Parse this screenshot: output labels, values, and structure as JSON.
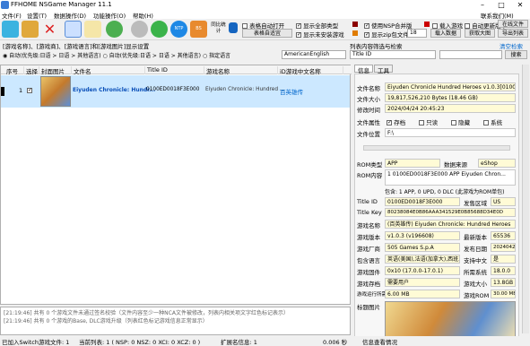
{
  "window": {
    "title": "FFHOME NSGame Manager 11.1",
    "minimize": "–",
    "maximize": "□",
    "close": "✕"
  },
  "menu": {
    "file": "文件(F)",
    "settings": "设置(T)",
    "data": "数据操作(D)",
    "function": "功能操作(O)",
    "help": "帮助(H)",
    "right_link": "联系我们(M)"
  },
  "toolbar": {
    "icons": [
      "new-file-icon",
      "folder-open-icon",
      "close-red-icon",
      "search-icon",
      "sleep-icon",
      "refresh-icon",
      "cancel-circle-icon",
      "checkmark-icon",
      "ntp-icon",
      "money-bag-icon",
      "palette-icon"
    ],
    "ntp_label": "NTP",
    "bs_label": "BS",
    "stats_label": "同比统计",
    "opt_auto_open": "表格自动打开",
    "opt_auto_open_checked": false,
    "opt_show_all_types": "显示全部类型",
    "opt_show_all_types_checked": true,
    "opt_real_name": "名称显示",
    "opt_real_name_checked": false,
    "opt_show_not_installed": "显示未安装游戏",
    "opt_show_not_installed_checked": true,
    "fit_width_btn": "表格自适宜",
    "opt_use_nsp_merge": "使用NSP合并版",
    "opt_use_nsp_merge_checked": true,
    "opt_show_nsz": "显示zip包文件名",
    "opt_show_nsz_checked": true,
    "count_value": "18",
    "opt_import_game": "载入游戏",
    "opt_import_game_checked": false,
    "opt_allow_comma": "允许逗号",
    "opt_allow_comma_checked": false,
    "load_db_btn": "载入数据",
    "opt_auto_update": "自动更新版本",
    "opt_auto_update_checked": false,
    "get_info_btn": "获取大图",
    "online_btn": "在线文件",
    "file_list_btn": "导出列表"
  },
  "filter": {
    "title": "[游戏名称]、[游戏商]、[游戏语言]和[游戏图片]显示设置",
    "row1_opt1": "自动(优先级:日语 > 日语 > 其他语言)",
    "row1_opt2": "自动(优先级:日语 > 日语 > 其他语言)",
    "row1_opt3": "指定语言",
    "lang_value": "AmericanEnglish",
    "search_title": "列表内容筛选与检索",
    "clear_link": "清空检索",
    "search_field": "Title ID",
    "search_value": "",
    "search_btn": "搜索"
  },
  "grid": {
    "headers": [
      "序号",
      "选择",
      "封面图片",
      "文件名",
      "Title ID",
      "游戏名称",
      "iD游戏中文名称"
    ],
    "rows": [
      {
        "no": "1",
        "checked": true,
        "filename": "Eiyuden Chronicle: Hundr...",
        "title_id": "0100ED0018F3E000",
        "game_name": "Eiyuden Chronicle: Hundred ...",
        "cn_name": "百英雄传"
      }
    ]
  },
  "log": {
    "line1": "[21:19:46] 共有 0 个游戏文件未通过签名校验（文件内容至少一种NCA文件被修改，列表内相关项文字红色标记表示）",
    "line2": "[21:19:46] 共有 0 个游戏的Base, DLC游戏升级（列表红色标记游戏信息正常显示）"
  },
  "status": {
    "load_count": "已加入Switch游戏文件: 1",
    "current": "当前列表: 1 ( NSP: 0  NSZ: 0  XCI: 0  XCZ: 0 )",
    "ext_data": "扩展名信息: 1",
    "size": "0.006 秒",
    "info_label": "信息查看情况"
  },
  "details": {
    "tabs": [
      "信息",
      "工具"
    ],
    "file_name_label": "文件名称",
    "file_name": "Eiyuden Chronicle Hundred Heroes v1.0.3[0100ED0...",
    "file_size_label": "文件大小",
    "file_size": "19,817,526,210 Bytes (18.46 GB)",
    "mod_time_label": "修改时间",
    "mod_time": "2024/04/24 20:45:23",
    "attr_label": "文件属性",
    "attr_archive": "存档",
    "attr_hidden": "只读",
    "attr_readonly": "隐藏",
    "attr_system": "系统",
    "attr_archive_checked": true,
    "attr_hidden_checked": false,
    "attr_readonly_checked": false,
    "attr_system_checked": false,
    "path_label": "文件位置",
    "path": "F:\\",
    "rom_type_label": "ROM类型",
    "rom_type": "APP",
    "data_source_label": "数据来源",
    "data_source": "eShop",
    "rom_content_label": "ROM内容",
    "rom_content": "1   0100ED0018F3E000   APP   Eiyuden Chron...",
    "content_summary": "包含: 1 APP, 0 UPD, 0 DLC  (此游戏为ROM单包)",
    "title_id_label": "Title ID",
    "title_id": "0100ED0018F3E000",
    "region_label": "发售区域",
    "region": "US",
    "title_key_label": "Title Key",
    "title_key": "80238084E0B86AAA341529E0B85688D34E0D",
    "game_name_label": "游戏名称",
    "game_name": "(百英雄传) Eiyuden Chronicle: Hundred Heroes",
    "version_label": "游戏版本",
    "version": "v1.0.3 (v196608)",
    "latest_version_label": "最新版本",
    "latest_version": "65536",
    "publisher_label": "游戏厂商",
    "publisher": "505 Games S.p.A",
    "release_label": "发布日期",
    "release": "20240423",
    "language_label": "包含语言",
    "language": "英语(美国),法语(加拿大),西班牙语(...",
    "lang_count_label": "支持中文",
    "lang_count": "是",
    "firmware_label": "游戏固件",
    "firmware": "0x10 (17.0.0-17.0.1)",
    "req_label": "所需系统",
    "req": "18.0.0",
    "saves_label": "游戏存档",
    "saves": "需要用户",
    "size_label": "游戏大小",
    "size": "13.8GB",
    "ram_label": "游戏运行所需内存",
    "ram": "6.00 MB",
    "rom_size_label": "游戏ROM",
    "rom_size": "30.00 MB",
    "cover_label": "标题图片"
  },
  "colors": {
    "accent": "#3a7bd5",
    "selected_row": "#cce8ff",
    "highlight": "#fffbd6",
    "link": "#0066cc",
    "cn_name": "#0066cc"
  }
}
